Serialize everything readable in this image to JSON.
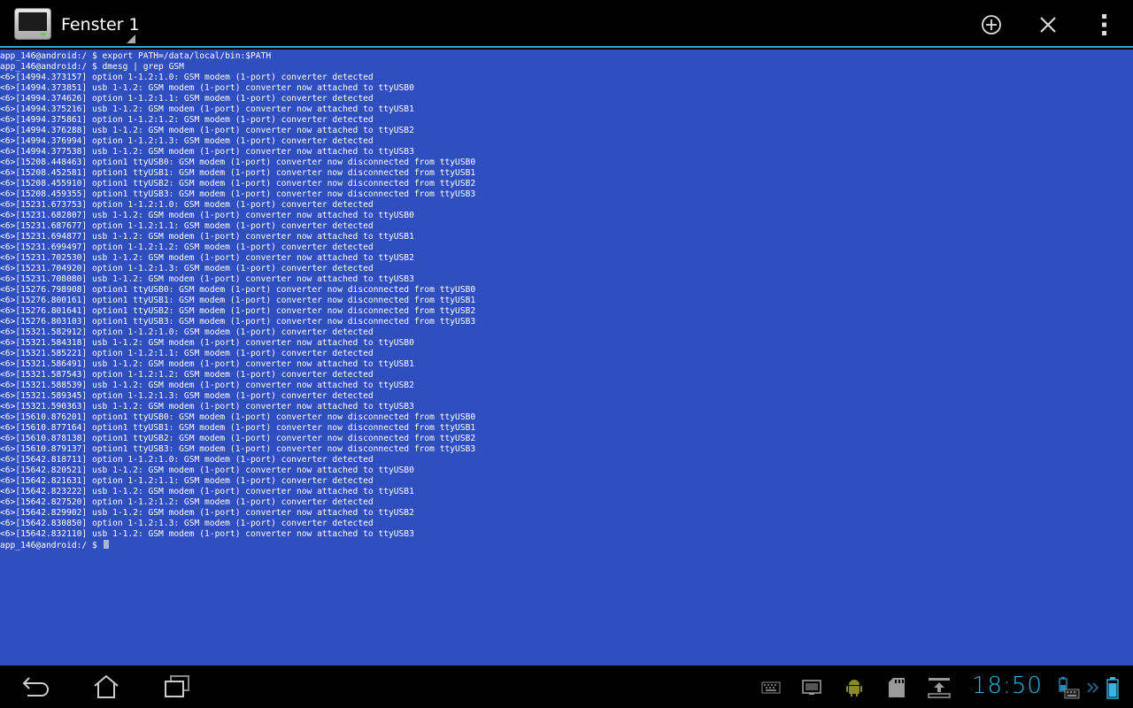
{
  "actionbar": {
    "title": "Fenster 1",
    "accent": "#2aa8d8"
  },
  "icons": {
    "app": "terminal-window-icon",
    "new_window": "add-circle-icon",
    "close": "close-icon",
    "overflow": "overflow-menu-icon",
    "back": "back-icon",
    "home": "home-icon",
    "recents": "recent-apps-icon",
    "keyboard": "keyboard-icon",
    "screenshot": "screenshot-icon",
    "android_debug": "android-debug-icon",
    "sdcard": "sdcard-icon",
    "download": "download-icon",
    "battery_dock": "dock-battery-icon",
    "battery": "battery-icon"
  },
  "terminal": {
    "background": "#2f4fbf",
    "lines": [
      "app_146@android:/ $ export PATH=/data/local/bin:$PATH",
      "app_146@android:/ $ dmesg | grep GSM",
      "<6>[14994.373157] option 1-1.2:1.0: GSM modem (1-port) converter detected",
      "<6>[14994.373851] usb 1-1.2: GSM modem (1-port) converter now attached to ttyUSB0",
      "<6>[14994.374626] option 1-1.2:1.1: GSM modem (1-port) converter detected",
      "<6>[14994.375216] usb 1-1.2: GSM modem (1-port) converter now attached to ttyUSB1",
      "<6>[14994.375861] option 1-1.2:1.2: GSM modem (1-port) converter detected",
      "<6>[14994.376288] usb 1-1.2: GSM modem (1-port) converter now attached to ttyUSB2",
      "<6>[14994.376994] option 1-1.2:1.3: GSM modem (1-port) converter detected",
      "<6>[14994.377538] usb 1-1.2: GSM modem (1-port) converter now attached to ttyUSB3",
      "<6>[15208.448463] option1 ttyUSB0: GSM modem (1-port) converter now disconnected from ttyUSB0",
      "<6>[15208.452581] option1 ttyUSB1: GSM modem (1-port) converter now disconnected from ttyUSB1",
      "<6>[15208.455910] option1 ttyUSB2: GSM modem (1-port) converter now disconnected from ttyUSB2",
      "<6>[15208.459355] option1 ttyUSB3: GSM modem (1-port) converter now disconnected from ttyUSB3",
      "<6>[15231.673753] option 1-1.2:1.0: GSM modem (1-port) converter detected",
      "<6>[15231.682807] usb 1-1.2: GSM modem (1-port) converter now attached to ttyUSB0",
      "<6>[15231.687677] option 1-1.2:1.1: GSM modem (1-port) converter detected",
      "<6>[15231.694877] usb 1-1.2: GSM modem (1-port) converter now attached to ttyUSB1",
      "<6>[15231.699497] option 1-1.2:1.2: GSM modem (1-port) converter detected",
      "<6>[15231.702530] usb 1-1.2: GSM modem (1-port) converter now attached to ttyUSB2",
      "<6>[15231.704920] option 1-1.2:1.3: GSM modem (1-port) converter detected",
      "<6>[15231.708080] usb 1-1.2: GSM modem (1-port) converter now attached to ttyUSB3",
      "<6>[15276.798908] option1 ttyUSB0: GSM modem (1-port) converter now disconnected from ttyUSB0",
      "<6>[15276.800161] option1 ttyUSB1: GSM modem (1-port) converter now disconnected from ttyUSB1",
      "<6>[15276.801641] option1 ttyUSB2: GSM modem (1-port) converter now disconnected from ttyUSB2",
      "<6>[15276.803103] option1 ttyUSB3: GSM modem (1-port) converter now disconnected from ttyUSB3",
      "<6>[15321.582912] option 1-1.2:1.0: GSM modem (1-port) converter detected",
      "<6>[15321.584318] usb 1-1.2: GSM modem (1-port) converter now attached to ttyUSB0",
      "<6>[15321.585221] option 1-1.2:1.1: GSM modem (1-port) converter detected",
      "<6>[15321.586491] usb 1-1.2: GSM modem (1-port) converter now attached to ttyUSB1",
      "<6>[15321.587543] option 1-1.2:1.2: GSM modem (1-port) converter detected",
      "<6>[15321.588539] usb 1-1.2: GSM modem (1-port) converter now attached to ttyUSB2",
      "<6>[15321.589345] option 1-1.2:1.3: GSM modem (1-port) converter detected",
      "<6>[15321.590363] usb 1-1.2: GSM modem (1-port) converter now attached to ttyUSB3",
      "<6>[15610.876201] option1 ttyUSB0: GSM modem (1-port) converter now disconnected from ttyUSB0",
      "<6>[15610.877164] option1 ttyUSB1: GSM modem (1-port) converter now disconnected from ttyUSB1",
      "<6>[15610.878138] option1 ttyUSB2: GSM modem (1-port) converter now disconnected from ttyUSB2",
      "<6>[15610.879137] option1 ttyUSB3: GSM modem (1-port) converter now disconnected from ttyUSB3",
      "<6>[15642.818711] option 1-1.2:1.0: GSM modem (1-port) converter detected",
      "<6>[15642.820521] usb 1-1.2: GSM modem (1-port) converter now attached to ttyUSB0",
      "<6>[15642.821631] option 1-1.2:1.1: GSM modem (1-port) converter detected",
      "<6>[15642.823222] usb 1-1.2: GSM modem (1-port) converter now attached to ttyUSB1",
      "<6>[15642.827520] option 1-1.2:1.2: GSM modem (1-port) converter detected",
      "<6>[15642.829902] usb 1-1.2: GSM modem (1-port) converter now attached to ttyUSB2",
      "<6>[15642.830850] option 1-1.2:1.3: GSM modem (1-port) converter detected",
      "<6>[15642.832110] usb 1-1.2: GSM modem (1-port) converter now attached to ttyUSB3"
    ],
    "prompt": "app_146@android:/ $ "
  },
  "sysbar": {
    "clock": "18:50",
    "clock_color": "#33b5e5"
  }
}
